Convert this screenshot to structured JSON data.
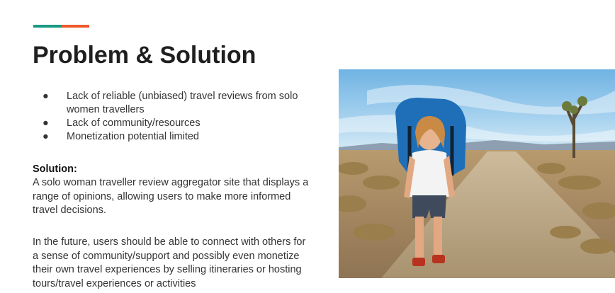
{
  "accent": {
    "left_color": "#1a9a85",
    "right_color": "#ee5a2a"
  },
  "slide": {
    "title": "Problem & Solution",
    "bullet_symbol": "●",
    "problems": [
      "Lack of reliable (unbiased) travel reviews from solo women travellers",
      "Lack of community/resources",
      "Monetization potential limited"
    ],
    "solution_heading": "Solution:",
    "solution_text": "A solo woman traveller review aggregator site that displays a range of opinions, allowing users to make more informed travel decisions.",
    "future_text": "In the future, users should be able to connect with others for a sense of community/support and possibly even monetize their own travel experiences by selling itineraries or hosting tours/travel experiences or activities"
  },
  "photo": {
    "subject": "woman hiker with large backpack on desert dirt road",
    "colors": {
      "sky": "#8fc4e8",
      "ground": "#c9a57a",
      "backpack": "#1f6fb8"
    }
  }
}
